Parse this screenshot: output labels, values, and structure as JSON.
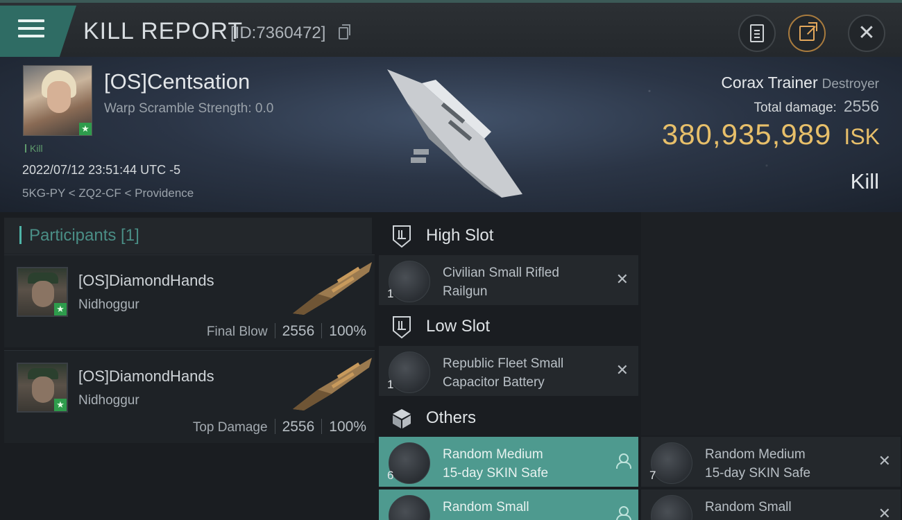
{
  "header": {
    "title": "KILL REPORT",
    "report_id": "[ID:7360472]",
    "menu_icon": "hamburger-menu-icon",
    "clipboard_icon": "clipboard-icon",
    "share_icon": "share-export-icon",
    "close_icon": "close-icon"
  },
  "victim": {
    "name": "[OS]Centsation",
    "warp_scramble": "Warp Scramble Strength: 0.0",
    "kill_tag": "Kill",
    "timestamp": "2022/07/12 23:51:44 UTC -5",
    "location": "5KG-PY < ZQ2-CF < Providence",
    "ship_name": "Corax Trainer",
    "ship_class": "Destroyer",
    "total_damage_label": "Total damage:",
    "total_damage": "2556",
    "isk_value": "380,935,989",
    "isk_unit": "ISK",
    "result": "Kill"
  },
  "participants": {
    "title": "Participants [1]",
    "rows": [
      {
        "name": "[OS]DiamondHands",
        "ship": "Nidhoggur",
        "role": "Final Blow",
        "damage": "2556",
        "percent": "100%"
      },
      {
        "name": "[OS]DiamondHands",
        "ship": "Nidhoggur",
        "role": "Top Damage",
        "damage": "2556",
        "percent": "100%"
      }
    ]
  },
  "slots": {
    "high": {
      "title": "High Slot",
      "items": [
        {
          "qty": "1",
          "name_line1": "Civilian Small Rifled",
          "name_line2": "Railgun"
        }
      ]
    },
    "low": {
      "title": "Low Slot",
      "items": [
        {
          "qty": "1",
          "name_line1": "Republic Fleet Small",
          "name_line2": "Capacitor Battery"
        }
      ]
    },
    "others": {
      "title": "Others",
      "items": [
        {
          "qty": "6",
          "name_line1": "Random Medium",
          "name_line2": "15-day SKIN Safe"
        },
        {
          "qty": "7",
          "name_line1": "Random Medium",
          "name_line2": "15-day SKIN Safe"
        },
        {
          "qty": "",
          "name_line1": "Random Small",
          "name_line2": ""
        },
        {
          "qty": "",
          "name_line1": "Random Small",
          "name_line2": ""
        }
      ]
    }
  },
  "colors": {
    "accent_teal": "#4e9a8f",
    "isk_gold": "#e7bf6a",
    "corp_star_green": "#2e9c4c"
  }
}
